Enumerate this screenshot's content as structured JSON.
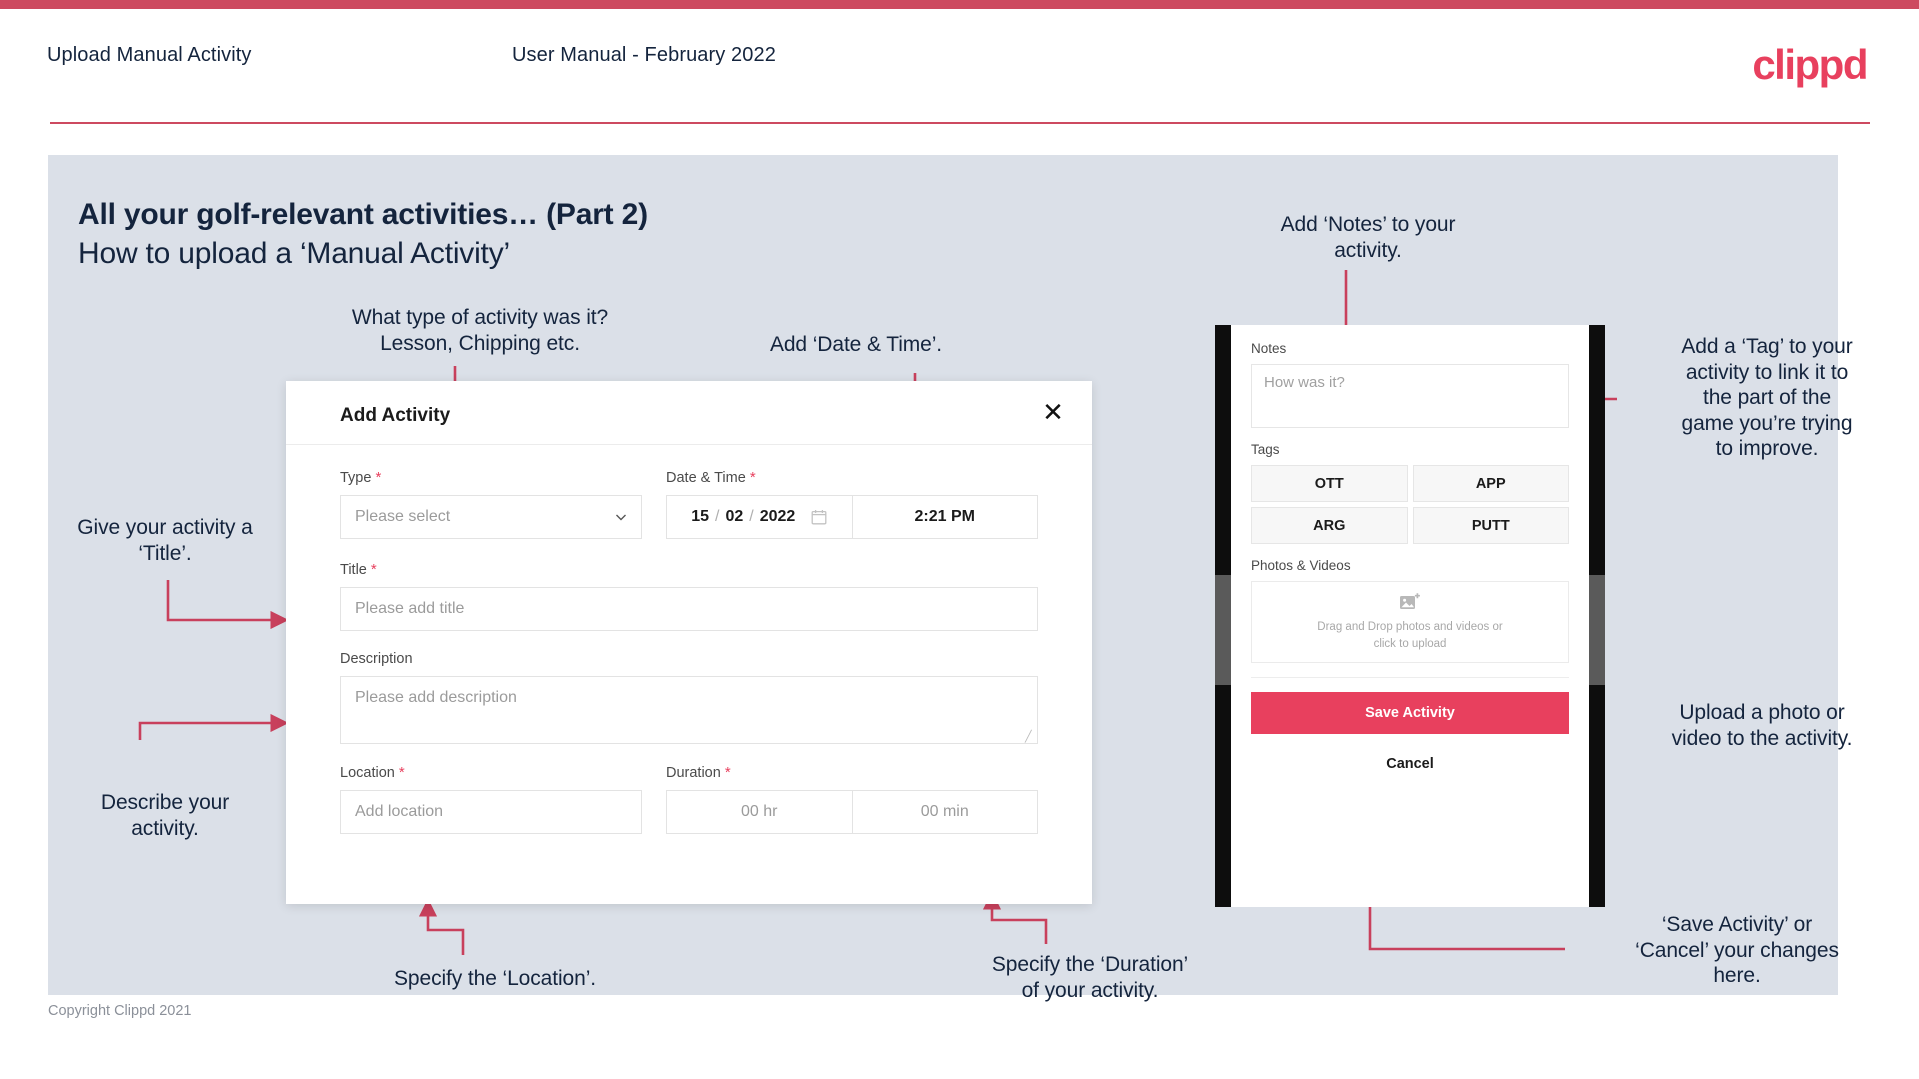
{
  "header": {
    "title": "Upload Manual Activity",
    "subtitle": "User Manual - February 2022",
    "logo": "clippd"
  },
  "slide": {
    "title": "All your golf-relevant activities… (Part 2)",
    "subtitle": "How to upload a ‘Manual Activity’"
  },
  "annotations": {
    "type": "What type of activity was it?\nLesson, Chipping etc.",
    "datetime": "Add ‘Date & Time’.",
    "title": "Give your activity a\n‘Title’.",
    "description": "Describe your\nactivity.",
    "location": "Specify the ‘Location’.",
    "duration": "Specify the ‘Duration’\nof your activity.",
    "notes": "Add ‘Notes’ to your\nactivity.",
    "tags": "Add a ‘Tag’ to your\nactivity to link it to\nthe part of the\ngame you’re trying\nto improve.",
    "upload": "Upload a photo or\nvideo to the activity.",
    "save": "‘Save Activity’ or\n‘Cancel’ your changes\nhere."
  },
  "modal": {
    "title": "Add Activity",
    "close_icon": "close-icon",
    "fields": {
      "type": {
        "label": "Type",
        "required": "*",
        "placeholder": "Please select",
        "icon": "chevron-down-icon"
      },
      "datetime": {
        "label": "Date & Time",
        "required": "*",
        "day": "15",
        "sep1": "/",
        "month": "02",
        "sep2": "/",
        "year": "2022",
        "icon": "calendar-icon",
        "time": "2:21 PM"
      },
      "title": {
        "label": "Title",
        "required": "*",
        "placeholder": "Please add title"
      },
      "description": {
        "label": "Description",
        "required": "",
        "placeholder": "Please add description"
      },
      "location": {
        "label": "Location",
        "required": "*",
        "placeholder": "Add location"
      },
      "duration": {
        "label": "Duration",
        "required": "*",
        "hours_placeholder": "00 hr",
        "minutes_placeholder": "00 min"
      }
    }
  },
  "phone": {
    "notes": {
      "label": "Notes",
      "placeholder": "How was it?"
    },
    "tags": {
      "label": "Tags",
      "items": [
        "OTT",
        "APP",
        "ARG",
        "PUTT"
      ]
    },
    "photos": {
      "label": "Photos & Videos",
      "icon": "add-image-icon",
      "drop_line1": "Drag and Drop photos and videos or",
      "drop_line2": "click to upload"
    },
    "save_label": "Save Activity",
    "cancel_label": "Cancel"
  },
  "footer": {
    "copyright": "Copyright Clippd 2021"
  },
  "colors": {
    "brand_pink": "#e8405e",
    "top_bar": "#cd4a60",
    "panel_bg": "#dbe0e8",
    "text_dark": "#14243d",
    "arrow": "#c8405c"
  }
}
